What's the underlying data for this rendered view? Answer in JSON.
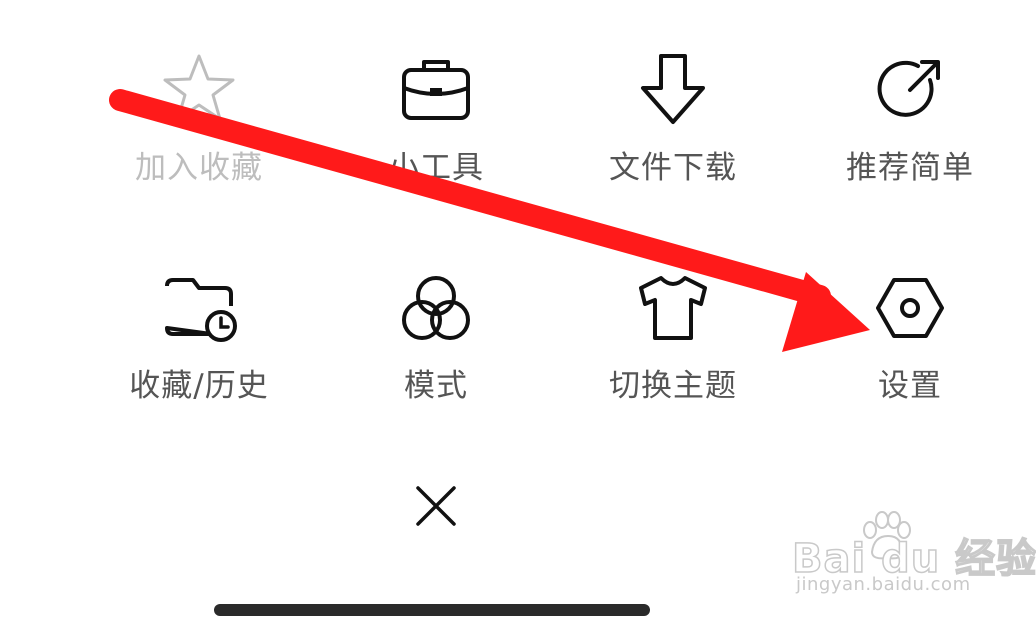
{
  "menu": {
    "row1": [
      {
        "label": "加入收藏",
        "icon": "star-icon",
        "disabled": true
      },
      {
        "label": "小工具",
        "icon": "briefcase-icon"
      },
      {
        "label": "文件下载",
        "icon": "download-arrow-icon"
      },
      {
        "label": "推荐简单",
        "icon": "share-arrow-icon"
      }
    ],
    "row2": [
      {
        "label": "收藏/历史",
        "icon": "folder-clock-icon"
      },
      {
        "label": "模式",
        "icon": "three-circles-icon"
      },
      {
        "label": "切换主题",
        "icon": "tshirt-icon"
      },
      {
        "label": "设置",
        "icon": "hexagon-settings-icon"
      }
    ]
  },
  "watermark": {
    "brand": "Bai du 经验",
    "url": "jingyan.baidu.com"
  },
  "colors": {
    "icon_stroke": "#111111",
    "label": "#555555",
    "label_disabled": "#bdbdbd",
    "annotation_arrow": "#ff1a1a",
    "home_indicator": "#2a2a2a"
  }
}
